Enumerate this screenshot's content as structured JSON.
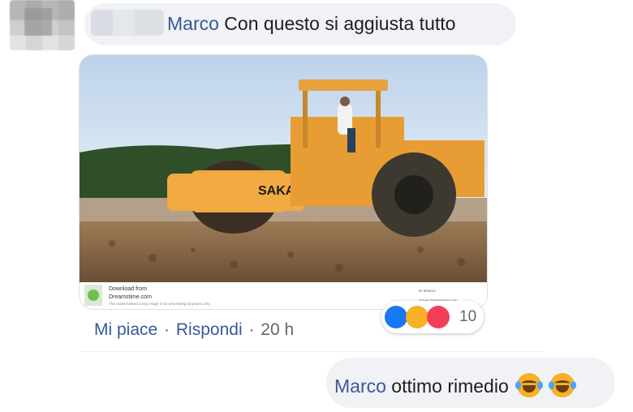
{
  "comment1": {
    "mention": "Marco",
    "text": "Con questo si aggiusta tutto"
  },
  "image": {
    "brand_text": "SAKAI",
    "watermark_text_1": "Download from",
    "watermark_text_2": "Dreamstime.com",
    "watermark_text_3": "This watermarked comp image is for previewing purposes only.",
    "side_text_1": "ID 601614",
    "side_text_2": "Travel Dreamstime.com"
  },
  "actions": {
    "like": "Mi piace",
    "reply": "Rispondi",
    "time": "20 h",
    "separator": "·"
  },
  "reactions": {
    "icons": [
      "like-icon",
      "haha-icon",
      "love-icon"
    ],
    "count": "10",
    "colors": {
      "like": "#1877f2",
      "haha": "#f7b125",
      "love": "#f33e58"
    }
  },
  "comment2": {
    "mention": "Marco",
    "text": "ottimo rimedio",
    "emojis": [
      "joy-emoji",
      "joy-emoji"
    ]
  },
  "colors": {
    "mention": "#385898",
    "bubble": "#f0f2f5",
    "text": "#1c1e21",
    "meta": "#65676b"
  }
}
